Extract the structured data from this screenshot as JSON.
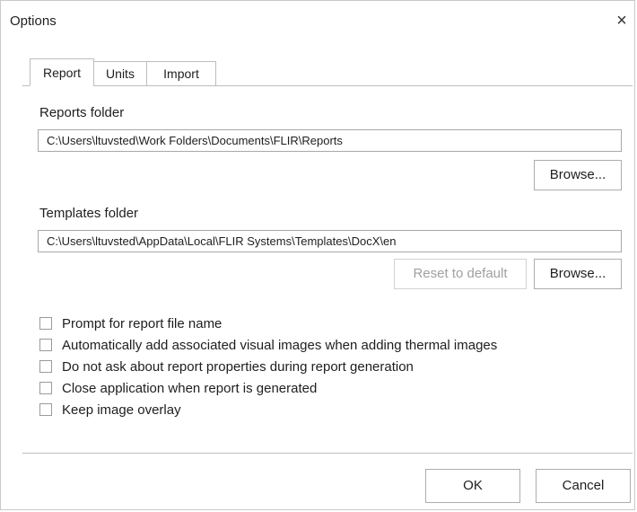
{
  "dialog": {
    "title": "Options",
    "close_glyph": "×"
  },
  "tabs": [
    {
      "label": "Report",
      "active": true
    },
    {
      "label": "Units",
      "active": false
    },
    {
      "label": "Import",
      "active": false
    }
  ],
  "reports_folder": {
    "label": "Reports folder",
    "value": "C:\\Users\\ltuvsted\\Work Folders\\Documents\\FLIR\\Reports",
    "browse_label": "Browse..."
  },
  "templates_folder": {
    "label": "Templates folder",
    "value": "C:\\Users\\ltuvsted\\AppData\\Local\\FLIR Systems\\Templates\\DocX\\en",
    "reset_label": "Reset to default",
    "browse_label": "Browse..."
  },
  "options": [
    {
      "label": "Prompt for report file name",
      "checked": false
    },
    {
      "label": "Automatically add associated visual images when adding thermal images",
      "checked": false
    },
    {
      "label": "Do not ask about report properties during report generation",
      "checked": false
    },
    {
      "label": "Close application when report is generated",
      "checked": false
    },
    {
      "label": "Keep image overlay",
      "checked": false
    }
  ],
  "footer": {
    "ok_label": "OK",
    "cancel_label": "Cancel"
  }
}
